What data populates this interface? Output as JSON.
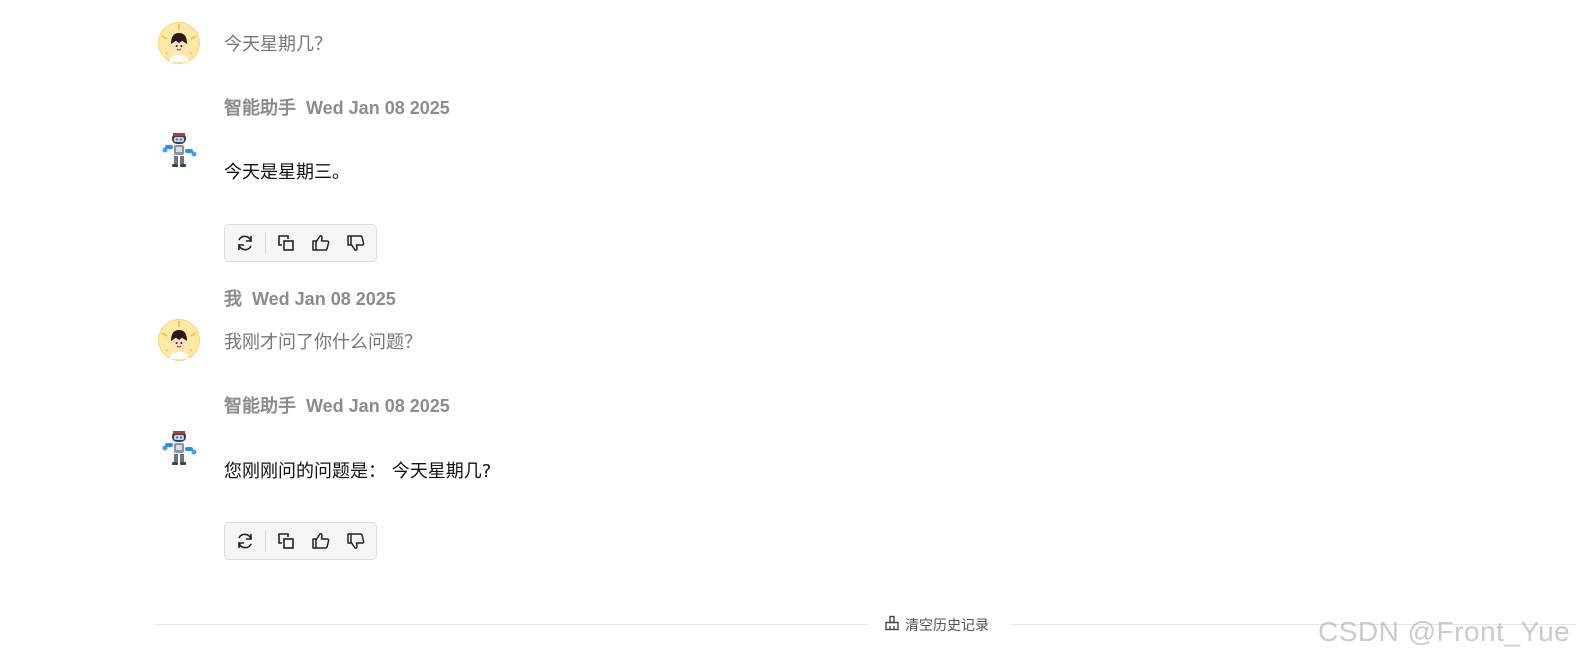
{
  "messages": [
    {
      "role": "user",
      "avatar_icon": "user-avatar-icon",
      "text": "今天星期几？"
    },
    {
      "role": "assistant",
      "sender": "智能助手",
      "date": "Wed Jan 08 2025",
      "avatar_icon": "robot-avatar-icon",
      "text": "今天是星期三。"
    },
    {
      "role": "user",
      "sender": "我",
      "date": "Wed Jan 08 2025",
      "avatar_icon": "user-avatar-icon",
      "text": "我刚才问了你什么问题？"
    },
    {
      "role": "assistant",
      "sender": "智能助手",
      "date": "Wed Jan 08 2025",
      "avatar_icon": "robot-avatar-icon",
      "text": "您刚刚问的问题是： 今天星期几?"
    }
  ],
  "toolbar_icons": [
    "refresh-icon",
    "copy-icon",
    "thumbs-up-icon",
    "thumbs-down-icon"
  ],
  "footer": {
    "clear_history_icon": "broom-icon",
    "clear_history_label": "清空历史记录"
  },
  "watermark": "CSDN @Front_Yue",
  "colors": {
    "meta_text": "#8c8c8c",
    "user_text": "#777777",
    "bot_text": "#111111",
    "toolbar_bg": "#f5f5f5",
    "toolbar_border": "#dcdcdc",
    "divider": "#e6e6e6"
  }
}
